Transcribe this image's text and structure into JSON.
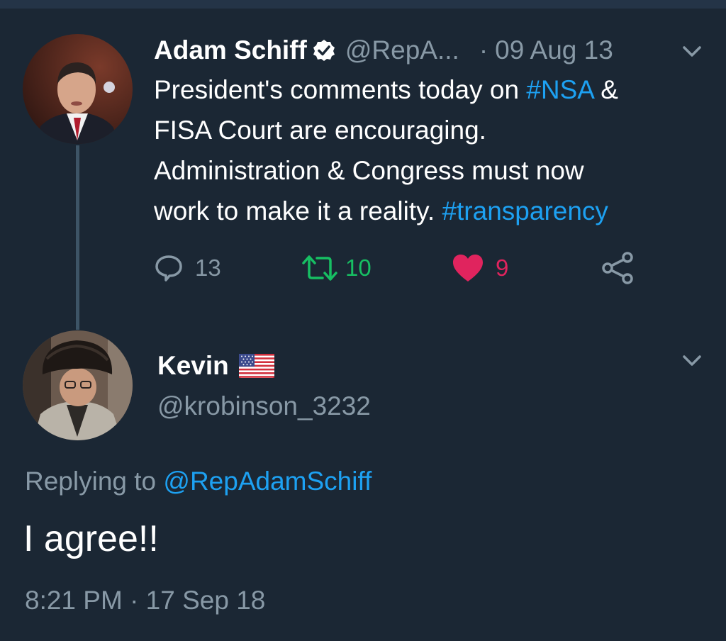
{
  "original_tweet": {
    "name": "Adam Schiff",
    "handle": "@RepA...",
    "separator": "·",
    "date": "09 Aug 13",
    "text_lines": [
      {
        "before": "President's comments today on ",
        "tag": "#NSA",
        "after": " &"
      },
      {
        "before": "FISA Court are encouraging.",
        "tag": "",
        "after": ""
      },
      {
        "before": "Administration & Congress must now",
        "tag": "",
        "after": ""
      },
      {
        "before": "work to make it a reality. ",
        "tag": "#transparency",
        "after": ""
      }
    ],
    "actions": {
      "replies": "13",
      "retweets": "10",
      "likes": "9"
    }
  },
  "reply_tweet": {
    "name": "Kevin",
    "handle": "@krobinson_3232",
    "replying_prefix": "Replying to ",
    "replying_to": "@RepAdamSchiff",
    "text": "I agree!!",
    "timestamp": "8:21 PM · 17 Sep 18"
  },
  "colors": {
    "background": "#1b2734",
    "link": "#1da1f2",
    "secondary_text": "#8899a6",
    "retweet_green": "#17bf63",
    "like_red": "#e0245e"
  },
  "icons": [
    "verified-badge-icon",
    "chevron-down-icon",
    "reply-icon",
    "retweet-icon",
    "heart-icon",
    "share-icon",
    "us-flag-icon"
  ]
}
